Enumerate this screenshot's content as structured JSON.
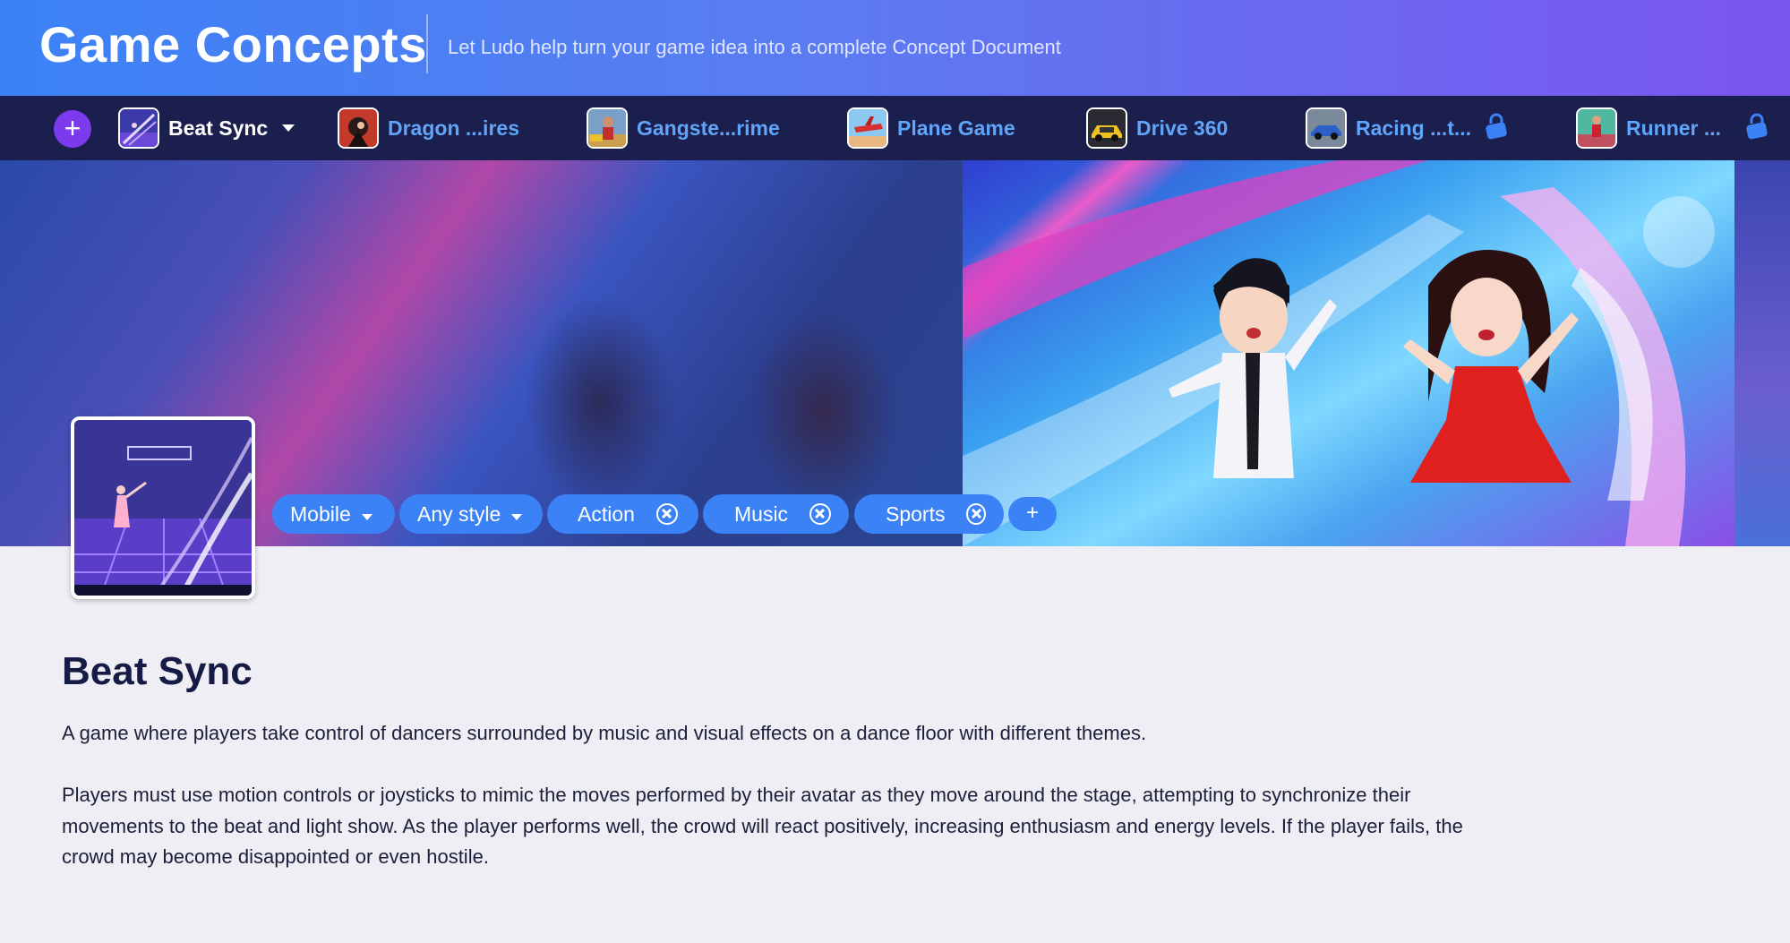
{
  "header": {
    "title": "Game Concepts",
    "subtitle": "Let Ludo help turn your game idea into a complete Concept Document"
  },
  "tabs": [
    {
      "label": "Beat Sync",
      "active": true,
      "icon": "beat-sync-thumb",
      "dropdown": true
    },
    {
      "label": "Dragon ...ires",
      "icon": "dragon-thumb"
    },
    {
      "label": "Gangste...rime",
      "icon": "gangster-thumb"
    },
    {
      "label": "Plane Game",
      "icon": "plane-thumb"
    },
    {
      "label": "Drive 360",
      "icon": "car-thumb"
    },
    {
      "label": "Racing ...t...",
      "icon": "racing-thumb",
      "locked": true
    },
    {
      "label": "Runner ...",
      "icon": "runner-thumb",
      "locked": true
    }
  ],
  "add_tab_label": "+",
  "tags": [
    {
      "label": "Mobile",
      "type": "dropdown"
    },
    {
      "label": "Any style",
      "type": "dropdown"
    },
    {
      "label": "Action",
      "type": "removable"
    },
    {
      "label": "Music",
      "type": "removable"
    },
    {
      "label": "Sports",
      "type": "removable"
    }
  ],
  "add_tag_label": "+",
  "game": {
    "title": "Beat Sync",
    "summary": "A game where players take control of dancers surrounded by music and visual effects on a dance floor with different themes.",
    "description": "Players must use motion controls or joysticks to mimic the moves performed by their avatar as they move around the stage, attempting to synchronize their movements to the beat and light show. As the player performs well, the crowd will react positively, increasing enthusiasm and energy levels. If the player fails, the crowd may become disappointed or even hostile."
  },
  "colors": {
    "header_gradient_start": "#3b82f6",
    "header_gradient_end": "#7b55ef",
    "tabbar_bg": "#1b1f4d",
    "tab_link": "#60a5fa",
    "tag_bg": "#3b82f6",
    "add_button": "#7c3aed",
    "title_text": "#161b45"
  }
}
